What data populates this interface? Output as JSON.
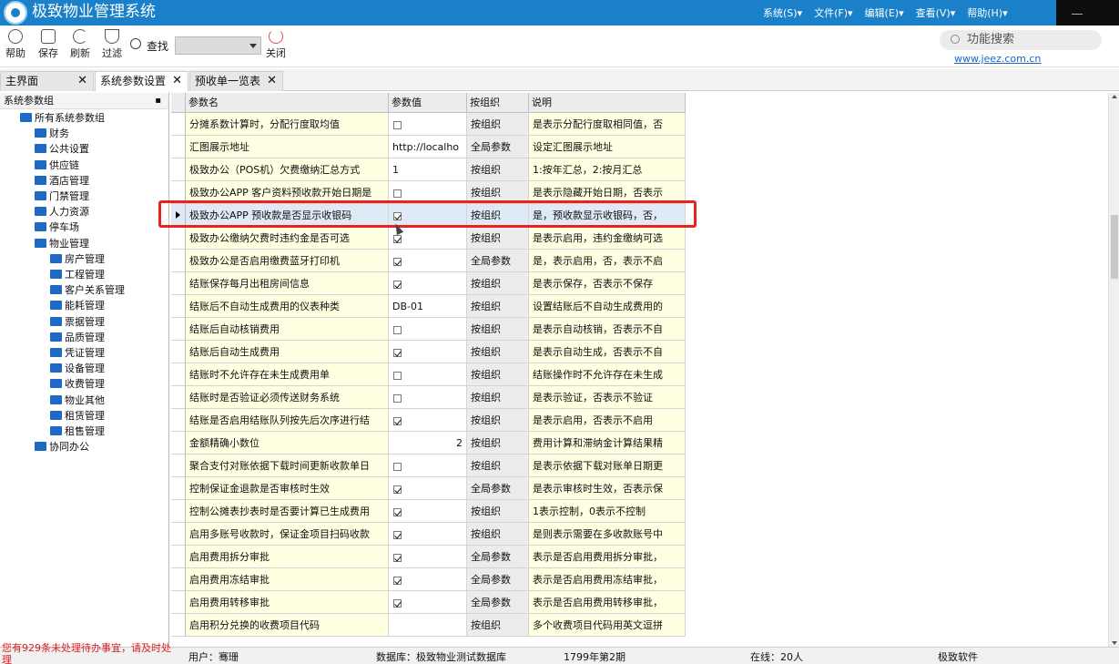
{
  "app": {
    "title": "极致物业管理系统"
  },
  "menu": [
    "系统(S)▾",
    "文件(F)▾",
    "编辑(E)▾",
    "查看(V)▾",
    "帮助(H)▾"
  ],
  "toolbar": {
    "help": "帮助",
    "save": "保存",
    "refresh": "刷新",
    "filter": "过滤",
    "find": "查找",
    "close": "关闭"
  },
  "func_search": "功能搜索",
  "site_link": "www.jeez.com.cn",
  "tabs": [
    "主界面",
    "系统参数设置",
    "预收单一览表"
  ],
  "left_panel": {
    "title": "系统参数组",
    "root": "所有系统参数组",
    "groups": [
      "财务",
      "公共设置",
      "供应链",
      "酒店管理",
      "门禁管理",
      "人力资源",
      "停车场",
      "物业管理"
    ],
    "property_children": [
      "房产管理",
      "工程管理",
      "客户关系管理",
      "能耗管理",
      "票据管理",
      "品质管理",
      "凭证管理",
      "设备管理",
      "收费管理",
      "物业其他",
      "租赁管理",
      "租售管理"
    ],
    "last": "协同办公"
  },
  "grid": {
    "headers": [
      "参数名",
      "参数值",
      "按组织",
      "说明"
    ],
    "rows": [
      {
        "name": "分摊系数计算时，分配行度取均值",
        "value": "",
        "check": false,
        "is_check": true,
        "scope": "按组织",
        "desc": "是表示分配行度取相同值，否"
      },
      {
        "name": "汇图展示地址",
        "value": "http://localho",
        "is_check": false,
        "scope": "全局参数",
        "desc": "设定汇图展示地址"
      },
      {
        "name": "极致办公（POS机）欠费缴纳汇总方式",
        "value": "1",
        "is_check": false,
        "scope": "按组织",
        "desc": "1:按年汇总，2:按月汇总"
      },
      {
        "name": "极致办公APP 客户资料预收款开始日期是",
        "value": "",
        "check": false,
        "is_check": true,
        "scope": "按组织",
        "desc": "是表示隐藏开始日期，否表示"
      },
      {
        "name": "极致办公APP 预收款是否显示收银码",
        "value": "",
        "check": true,
        "is_check": true,
        "scope": "按组织",
        "desc": "是，预收款显示收银码，否，"
      },
      {
        "name": "极致办公缴纳欠费时违约金是否可选",
        "value": "",
        "check": true,
        "is_check": true,
        "scope": "按组织",
        "desc": "是表示启用，违约金缴纳可选"
      },
      {
        "name": "极致办公是否启用缴费蓝牙打印机",
        "value": "",
        "check": true,
        "is_check": true,
        "scope": "全局参数",
        "desc": "是，表示启用，否，表示不启"
      },
      {
        "name": "结账保存每月出租房间信息",
        "value": "",
        "check": true,
        "is_check": true,
        "scope": "按组织",
        "desc": "是表示保存，否表示不保存"
      },
      {
        "name": "结账后不自动生成费用的仪表种类",
        "value": "DB-01",
        "is_check": false,
        "scope": "按组织",
        "desc": "设置结账后不自动生成费用的"
      },
      {
        "name": "结账后自动核销费用",
        "value": "",
        "check": false,
        "is_check": true,
        "scope": "按组织",
        "desc": "是表示自动核销，否表示不自"
      },
      {
        "name": "结账后自动生成费用",
        "value": "",
        "check": true,
        "is_check": true,
        "scope": "按组织",
        "desc": "是表示自动生成，否表示不自"
      },
      {
        "name": "结账时不允许存在未生成费用单",
        "value": "",
        "check": false,
        "is_check": true,
        "scope": "按组织",
        "desc": "结账操作时不允许存在未生成"
      },
      {
        "name": "结账时是否验证必须传送财务系统",
        "value": "",
        "check": false,
        "is_check": true,
        "scope": "按组织",
        "desc": "是表示验证，否表示不验证"
      },
      {
        "name": "结账是否启用结账队列按先后次序进行结",
        "value": "",
        "check": true,
        "is_check": true,
        "scope": "按组织",
        "desc": "是表示启用，否表示不启用"
      },
      {
        "name": "金额精确小数位",
        "value": "2",
        "is_check": false,
        "right": true,
        "scope": "按组织",
        "desc": "费用计算和滞纳金计算结果精"
      },
      {
        "name": "聚合支付对账依据下载时间更新收款单日",
        "value": "",
        "check": false,
        "is_check": true,
        "scope": "按组织",
        "desc": "是表示依据下载对账单日期更"
      },
      {
        "name": "控制保证金退款是否审核时生效",
        "value": "",
        "check": true,
        "is_check": true,
        "scope": "全局参数",
        "desc": "是表示审核时生效，否表示保"
      },
      {
        "name": "控制公摊表抄表时是否要计算已生成费用",
        "value": "",
        "check": true,
        "is_check": true,
        "scope": "按组织",
        "desc": "1表示控制，0表示不控制"
      },
      {
        "name": "启用多账号收款时，保证金项目扫码收款",
        "value": "",
        "check": true,
        "is_check": true,
        "scope": "按组织",
        "desc": "是则表示需要在多收款账号中"
      },
      {
        "name": "启用费用拆分审批",
        "value": "",
        "check": true,
        "is_check": true,
        "scope": "全局参数",
        "desc": "表示是否启用费用拆分审批，"
      },
      {
        "name": "启用费用冻结审批",
        "value": "",
        "check": true,
        "is_check": true,
        "scope": "全局参数",
        "desc": "表示是否启用费用冻结审批，"
      },
      {
        "name": "启用费用转移审批",
        "value": "",
        "check": true,
        "is_check": true,
        "scope": "全局参数",
        "desc": "表示是否启用费用转移审批，"
      },
      {
        "name": "启用积分兑换的收费项目代码",
        "value": "",
        "is_check": false,
        "scope": "按组织",
        "desc": "多个收费项目代码用英文逗拼"
      }
    ]
  },
  "status": {
    "warning": "您有929条未处理待办事宜，请及时处理",
    "user": "用户：骞珊",
    "db": "数据库：极致物业测试数据库",
    "period": "1799年第2期",
    "online": "在线：20人",
    "vendor": "极致软件"
  }
}
